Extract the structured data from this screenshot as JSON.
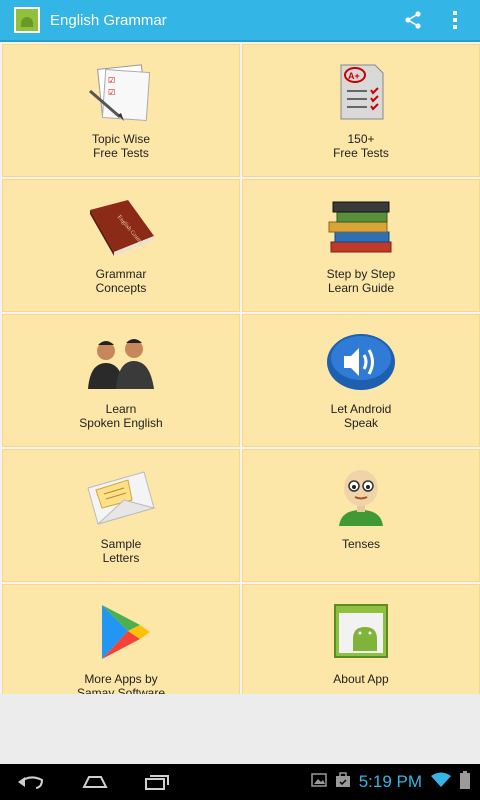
{
  "app": {
    "title": "English Grammar"
  },
  "tiles": [
    {
      "line1": "Topic Wise",
      "line2": "Free Tests"
    },
    {
      "line1": "150+",
      "line2": "Free Tests"
    },
    {
      "line1": "Grammar",
      "line2": "Concepts"
    },
    {
      "line1": "Step by Step",
      "line2": "Learn Guide"
    },
    {
      "line1": "Learn",
      "line2": "Spoken English"
    },
    {
      "line1": "Let Android",
      "line2": "Speak"
    },
    {
      "line1": "Sample",
      "line2": "Letters"
    },
    {
      "line1": "Tenses",
      "line2": ""
    },
    {
      "line1": "More Apps by",
      "line2": "Samay Software"
    },
    {
      "line1": "About App",
      "line2": ""
    }
  ],
  "status": {
    "time": "5:19 PM"
  },
  "icons": {
    "share": "share-icon",
    "overflow": "overflow-menu-icon",
    "back": "back-icon",
    "home": "home-icon",
    "recents": "recent-apps-icon"
  },
  "colors": {
    "actionbar": "#33b5e5",
    "tile": "#fde7a8",
    "clock": "#33b5e5"
  }
}
